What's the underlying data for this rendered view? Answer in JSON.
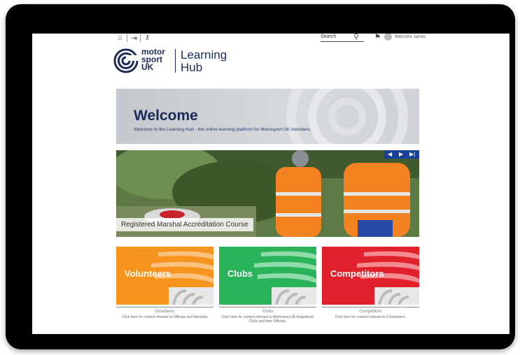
{
  "topbar": {
    "search_placeholder": "Search",
    "welcome_user": "Welcome James"
  },
  "logo": {
    "org_line1": "motor",
    "org_line2": "sport",
    "org_line3": "UK",
    "product_line1": "Learning",
    "product_line2": "Hub"
  },
  "banner": {
    "title": "Welcome",
    "subtitle": "Welcome to the Learning Hub - the online learning platform for Motorsport UK members."
  },
  "slider": {
    "caption": "Registered Marshal Accreditation Course",
    "controls": [
      "◀",
      "▶",
      "▶|"
    ]
  },
  "tiles": [
    {
      "label": "Volunteers",
      "name": "Volunteers",
      "description": "Click here for content relevant to Officials and Marshals",
      "color": "#f7941d"
    },
    {
      "label": "Clubs",
      "name": "Clubs",
      "description": "Click here for content relevant to Motorsport UK-Registered Clubs and their Officials.",
      "color": "#2bb35b"
    },
    {
      "label": "Competitors",
      "name": "Competitors",
      "description": "Click here for content relevant to Competitors.",
      "color": "#e0202a"
    }
  ],
  "colors": {
    "brand_navy": "#1c2a5a",
    "slider_control_bg": "#1a3f9a"
  }
}
